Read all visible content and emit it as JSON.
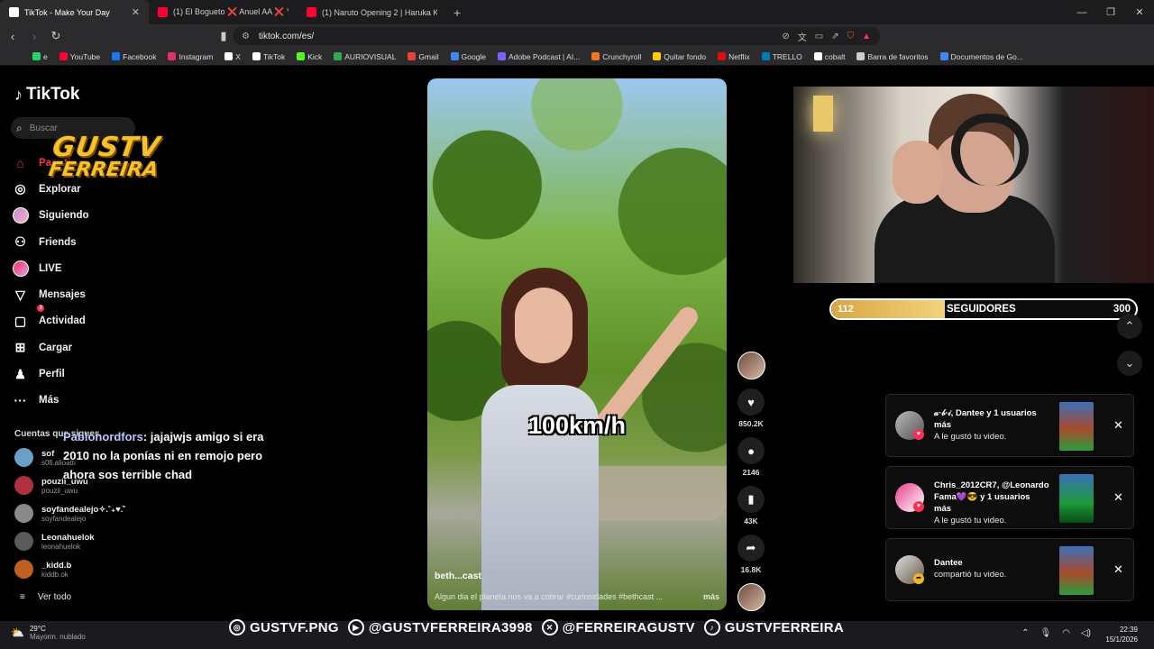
{
  "browser": {
    "tabs": [
      {
        "label": "TikTok - Make Your Day",
        "active": true,
        "favicon_color": "#ffffff"
      },
      {
        "label": "(1) El Bogueto ❌ Anuel AA ❌ Yung",
        "active": false,
        "favicon_color": "#ff0033"
      },
      {
        "label": "(1) Naruto Opening 2 | Haruka Kanat",
        "active": false,
        "favicon_color": "#ff0033"
      }
    ],
    "url": "tiktok.com/es/",
    "bookmarks": [
      {
        "label": "e",
        "color": "#25d366"
      },
      {
        "label": "YouTube",
        "color": "#ff0033"
      },
      {
        "label": "Facebook",
        "color": "#1877f2"
      },
      {
        "label": "Instagram",
        "color": "#e1306c"
      },
      {
        "label": "X",
        "color": "#ffffff"
      },
      {
        "label": "TikTok",
        "color": "#ffffff"
      },
      {
        "label": "Kick",
        "color": "#53fc18"
      },
      {
        "label": "AURIOVISUAL",
        "color": "#34a853"
      },
      {
        "label": "Gmail",
        "color": "#ea4335"
      },
      {
        "label": "Google",
        "color": "#4285f4"
      },
      {
        "label": "Adobe Podcast | AI...",
        "color": "#7b61ff"
      },
      {
        "label": "Crunchyroll",
        "color": "#f47521"
      },
      {
        "label": "Quitar fondo",
        "color": "#ffcc00"
      },
      {
        "label": "Netflix",
        "color": "#e50914"
      },
      {
        "label": "TRELLO",
        "color": "#0079bf"
      },
      {
        "label": "cobalt",
        "color": "#ffffff"
      },
      {
        "label": "Barra de favoritos",
        "color": "#cccccc"
      },
      {
        "label": "Documentos de Go...",
        "color": "#4285f4"
      }
    ]
  },
  "tiktok": {
    "logo": "TikTok",
    "search_placeholder": "Buscar",
    "nav": [
      {
        "label": "Para ti",
        "icon": "home-icon",
        "active": true
      },
      {
        "label": "Explorar",
        "icon": "compass-icon"
      },
      {
        "label": "Siguiendo",
        "icon": "avatar-icon"
      },
      {
        "label": "Friends",
        "icon": "friends-icon"
      },
      {
        "label": "LIVE",
        "icon": "live-icon"
      },
      {
        "label": "Mensajes",
        "icon": "send-icon"
      },
      {
        "label": "Actividad",
        "icon": "activity-icon",
        "badge": "3"
      },
      {
        "label": "Cargar",
        "icon": "plus-icon"
      },
      {
        "label": "Perfil",
        "icon": "profile-icon"
      },
      {
        "label": "Más",
        "icon": "more-icon"
      }
    ],
    "following_title": "Cuentas que sigues",
    "accounts": [
      {
        "name": "sof",
        "handle": "s0fi.alioatti",
        "color": "#6aa0c8"
      },
      {
        "name": "pouzii_uwu",
        "handle": "pouzii_uwu",
        "color": "#b03040"
      },
      {
        "name": "soyfandealejo✧.˚₊♥.̇˚",
        "handle": "soyfandealejo",
        "color": "#8a8a8a"
      },
      {
        "name": "Leonahuelok",
        "handle": "leonahuelok",
        "color": "#5a5a5a"
      },
      {
        "name": "_kidd.b",
        "handle": "kiddb.ok",
        "color": "#c06020"
      }
    ],
    "see_all": "Ver todo",
    "video": {
      "overlay_text": "100km/h",
      "author": "beth...cast",
      "description": "Algun dia el planeta nos va a cobrar #curiosidades #bethcast ...",
      "more": "más",
      "likes": "850.2K",
      "comments": "2146",
      "saves": "43K",
      "shares": "16.8K"
    },
    "notifications": [
      {
        "text": "𝒶·𝒷·𝒾, Dantee y 1 usuarios más",
        "sub": "A le gustó tu video.",
        "type": "like"
      },
      {
        "text": "Chris_2012CR7, @Leonardo Fama💜😎 y 1 usuarios más",
        "sub": "A le gustó tu video.",
        "type": "like"
      },
      {
        "text": "Dantee",
        "sub": "compartió tu video.",
        "type": "share"
      }
    ]
  },
  "stream": {
    "brand_line1": "GUSTV",
    "brand_line2": "FERREIRA",
    "chat_user": "Pablonordfors",
    "chat_message": ": jajajwjs amigo si era 2010 no la ponías ni en remojo pero ahora sos terrible chad",
    "followers_current": "112",
    "followers_label": "SEGUIDORES",
    "followers_goal": "300",
    "followers_progress": 0.373,
    "socials": [
      {
        "label": "GUSTVF.PNG",
        "icon": "instagram-icon"
      },
      {
        "label": "@GUSTVFERREIRA3998",
        "icon": "youtube-icon"
      },
      {
        "label": "@FERREIRAGUSTV",
        "icon": "x-icon"
      },
      {
        "label": "GUSTVFERREIRA",
        "icon": "tiktok-icon"
      }
    ]
  },
  "taskbar": {
    "temp": "29°C",
    "weather": "Mayorm. nublado",
    "time": "22:39",
    "date": "15/1/2026"
  }
}
